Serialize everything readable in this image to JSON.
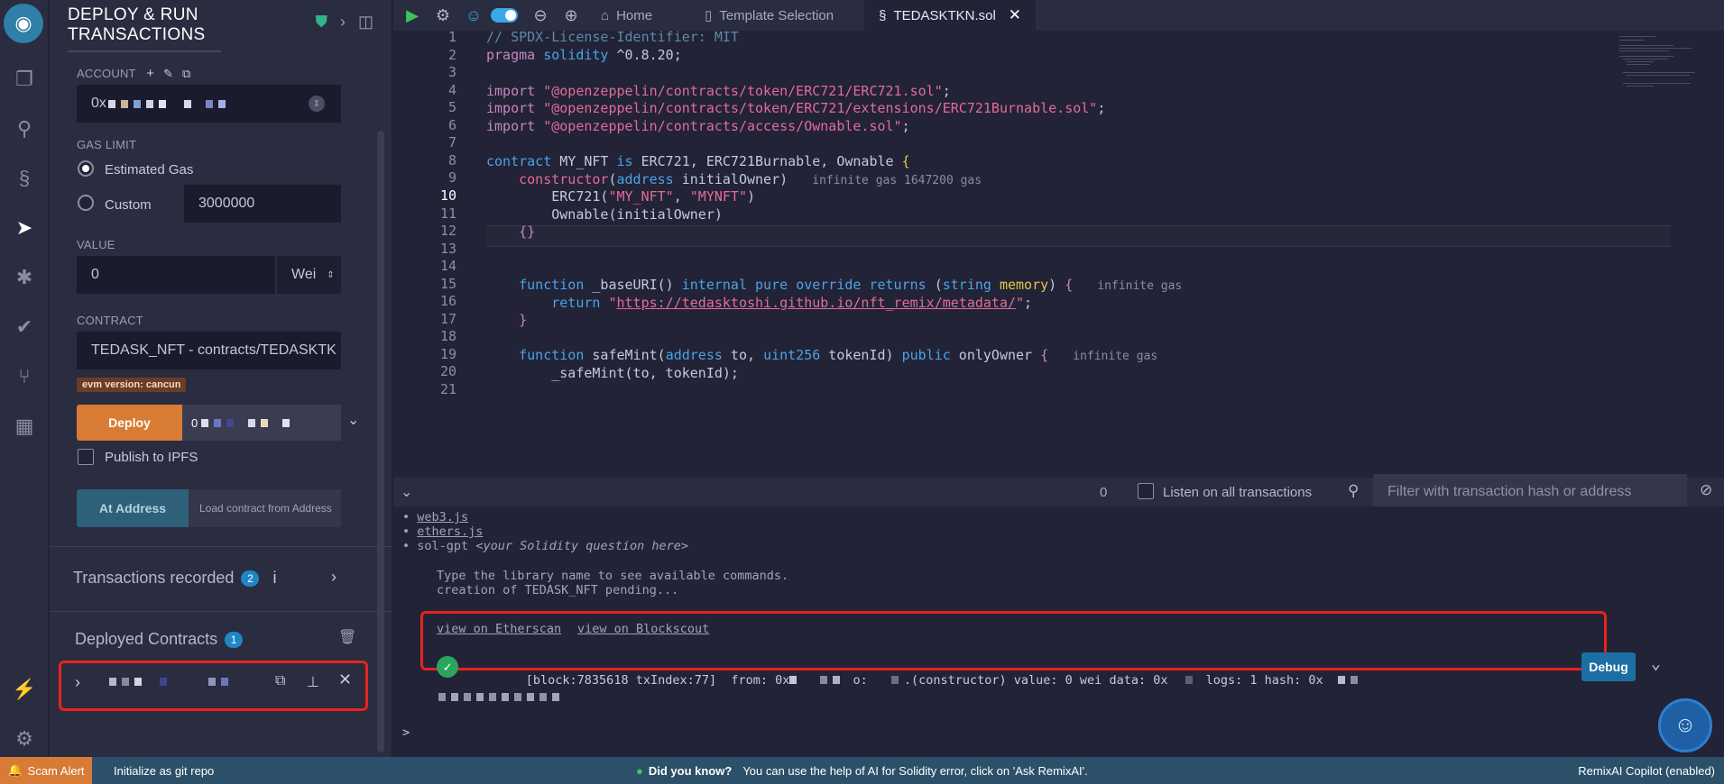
{
  "panel": {
    "title_line1": "DEPLOY & RUN",
    "title_line2": "TRANSACTIONS",
    "account_label": "ACCOUNT",
    "account_value": "0x",
    "gas_limit_label": "GAS LIMIT",
    "gas_estimated": "Estimated Gas",
    "gas_custom": "Custom",
    "gas_custom_value": "3000000",
    "value_label": "VALUE",
    "value_amount": "0",
    "value_unit": "Wei",
    "contract_label": "CONTRACT",
    "contract_value": "TEDASK_NFT - contracts/TEDASKTK",
    "evm_badge": "evm version: cancun",
    "deploy_button": "Deploy",
    "deploy_arg": "0",
    "publish_ipfs": "Publish to IPFS",
    "at_address_button": "At Address",
    "load_contract_placeholder": "Load contract from Address",
    "transactions_recorded": "Transactions recorded",
    "transactions_recorded_count": "2",
    "info_glyph": "i",
    "deployed_contracts": "Deployed Contracts",
    "deployed_contracts_count": "1"
  },
  "tabs": {
    "home": "Home",
    "template": "Template Selection",
    "file": "TEDASKTKN.sol"
  },
  "editor": {
    "line_numbers": [
      "1",
      "2",
      "3",
      "4",
      "5",
      "6",
      "7",
      "8",
      "9",
      "10",
      "11",
      "12",
      "13",
      "14",
      "15",
      "16",
      "17",
      "18",
      "19",
      "20",
      "21"
    ],
    "hint_constructor": "infinite gas 1647200 gas",
    "hint_baseuri": "infinite gas",
    "hint_safemint": "infinite gas"
  },
  "terminal": {
    "tx_count": "0",
    "listen_label": "Listen on all transactions",
    "filter_placeholder": "Filter with transaction hash or address",
    "lib_web3": "web3.js",
    "lib_ethers": "ethers.js",
    "lib_solgpt": "sol-gpt",
    "lib_solgpt_hint": "<your Solidity question here>",
    "type_hint": "Type the library name to see available commands.",
    "pending": "creation of TEDASK_NFT pending...",
    "etherscan_link": "view on Etherscan",
    "blockscout_link": "view on Blockscout",
    "tx_block": "[block:7835618 txIndex:77]",
    "tx_from": "from: 0x",
    "tx_to": "o:",
    "tx_constructor": ".(constructor)",
    "tx_value": "value: 0 wei",
    "tx_data": "data: 0x",
    "tx_logs": "logs: 1",
    "tx_hash": "hash: 0x",
    "debug_button": "Debug",
    "prompt": ">"
  },
  "status": {
    "scam_alert": "Scam Alert",
    "init_git": "Initialize as git repo",
    "did_you_know": "Did you know?",
    "tip": "You can use the help of AI for Solidity error, click on 'Ask RemixAI'.",
    "copilot": "RemixAI Copilot (enabled)"
  },
  "colors": {
    "accent_blue": "#1f86c6",
    "deploy_orange": "#d87c35",
    "highlight_red": "#e8231c",
    "success_green": "#28a55f"
  }
}
